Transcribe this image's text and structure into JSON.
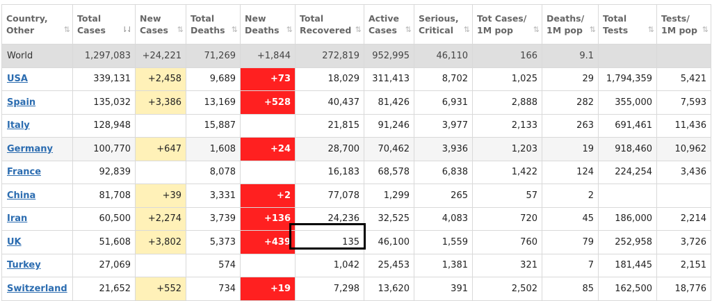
{
  "columns": [
    {
      "label": [
        "Country,",
        "Other"
      ]
    },
    {
      "label": [
        "Total",
        "Cases"
      ],
      "sorted": true
    },
    {
      "label": [
        "New",
        "Cases"
      ]
    },
    {
      "label": [
        "Total",
        "Deaths"
      ]
    },
    {
      "label": [
        "New",
        "Deaths"
      ]
    },
    {
      "label": [
        "Total",
        "Recovered"
      ]
    },
    {
      "label": [
        "Active",
        "Cases"
      ]
    },
    {
      "label": [
        "Serious,",
        "Critical"
      ]
    },
    {
      "label": [
        "Tot  Cases/",
        "1M pop"
      ]
    },
    {
      "label": [
        "Deaths/",
        "1M pop"
      ]
    },
    {
      "label": [
        "Total",
        "Tests"
      ]
    },
    {
      "label": [
        "Tests/",
        "1M pop"
      ]
    }
  ],
  "sort_icons": {
    "default": "⇅",
    "active": "⇂⇃"
  },
  "rows": [
    {
      "type": "world",
      "cells": [
        "World",
        "1,297,083",
        "+24,221",
        "71,269",
        "+1,844",
        "272,819",
        "952,995",
        "46,110",
        "166",
        "9.1",
        "",
        ""
      ]
    },
    {
      "type": "country",
      "cells": [
        "USA",
        "339,131",
        "+2,458",
        "9,689",
        "+73",
        "18,029",
        "311,413",
        "8,702",
        "1,025",
        "29",
        "1,794,359",
        "5,421"
      ]
    },
    {
      "type": "country",
      "cells": [
        "Spain",
        "135,032",
        "+3,386",
        "13,169",
        "+528",
        "40,437",
        "81,426",
        "6,931",
        "2,888",
        "282",
        "355,000",
        "7,593"
      ]
    },
    {
      "type": "country",
      "cells": [
        "Italy",
        "128,948",
        "",
        "15,887",
        "",
        "21,815",
        "91,246",
        "3,977",
        "2,133",
        "263",
        "691,461",
        "11,436"
      ]
    },
    {
      "type": "country",
      "alt": true,
      "cells": [
        "Germany",
        "100,770",
        "+647",
        "1,608",
        "+24",
        "28,700",
        "70,462",
        "3,936",
        "1,203",
        "19",
        "918,460",
        "10,962"
      ]
    },
    {
      "type": "country",
      "cells": [
        "France",
        "92,839",
        "",
        "8,078",
        "",
        "16,183",
        "68,578",
        "6,838",
        "1,422",
        "124",
        "224,254",
        "3,436"
      ]
    },
    {
      "type": "country",
      "cells": [
        "China",
        "81,708",
        "+39",
        "3,331",
        "+2",
        "77,078",
        "1,299",
        "265",
        "57",
        "2",
        "",
        ""
      ]
    },
    {
      "type": "country",
      "cells": [
        "Iran",
        "60,500",
        "+2,274",
        "3,739",
        "+136",
        "24,236",
        "32,525",
        "4,083",
        "720",
        "45",
        "186,000",
        "2,214"
      ]
    },
    {
      "type": "country",
      "cells": [
        "UK",
        "51,608",
        "+3,802",
        "5,373",
        "+439",
        "135",
        "46,100",
        "1,559",
        "760",
        "79",
        "252,958",
        "3,726"
      ]
    },
    {
      "type": "country",
      "cells": [
        "Turkey",
        "27,069",
        "",
        "574",
        "",
        "1,042",
        "25,453",
        "1,381",
        "321",
        "7",
        "181,445",
        "2,151"
      ]
    },
    {
      "type": "country",
      "cells": [
        "Switzerland",
        "21,652",
        "+552",
        "734",
        "+19",
        "7,298",
        "13,620",
        "391",
        "2,502",
        "85",
        "162,500",
        "18,776"
      ]
    }
  ],
  "colors": {
    "new_cases_bg": "#fff1b8",
    "new_deaths_bg": "#ff2020",
    "world_row_bg": "#dfdfdf",
    "link": "#2b6cb0",
    "highlight_border": "#000000"
  }
}
